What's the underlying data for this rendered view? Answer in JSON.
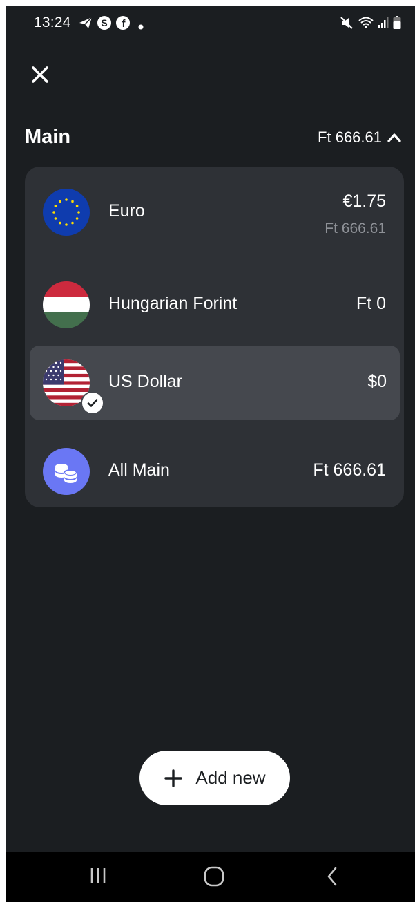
{
  "status_bar": {
    "time": "13:24",
    "left_icons": [
      "telegram-icon",
      "skype-icon",
      "facebook-icon",
      "notification-dot"
    ],
    "right_icons": [
      "mute-icon",
      "wifi-icon",
      "signal-icon",
      "battery-icon"
    ]
  },
  "header": {
    "close_icon": "close-icon"
  },
  "section": {
    "title": "Main",
    "total": "Ft 666.61",
    "toggle_icon": "chevron-up-icon"
  },
  "accounts": [
    {
      "name": "Euro",
      "amount": "€1.75",
      "converted": "Ft 666.61",
      "icon": "eu-flag-icon",
      "selected": false
    },
    {
      "name": "Hungarian Forint",
      "amount": "Ft 0",
      "icon": "hungary-flag-icon",
      "selected": false
    },
    {
      "name": "US Dollar",
      "amount": "$0",
      "icon": "us-flag-icon",
      "selected": true,
      "badge_icon": "check-icon"
    },
    {
      "name": "All Main",
      "amount": "Ft 666.61",
      "icon": "coins-icon",
      "selected": false
    }
  ],
  "add_button": {
    "label": "Add new",
    "icon": "plus-icon"
  },
  "nav_bar": {
    "items": [
      "recent-apps-icon",
      "home-icon",
      "back-icon"
    ]
  },
  "colors": {
    "background": "#1b1e21",
    "card": "#2e3136",
    "selected_row": "#45484e",
    "secondary_text": "#8e9197",
    "coins_accent": "#6a77f4"
  }
}
